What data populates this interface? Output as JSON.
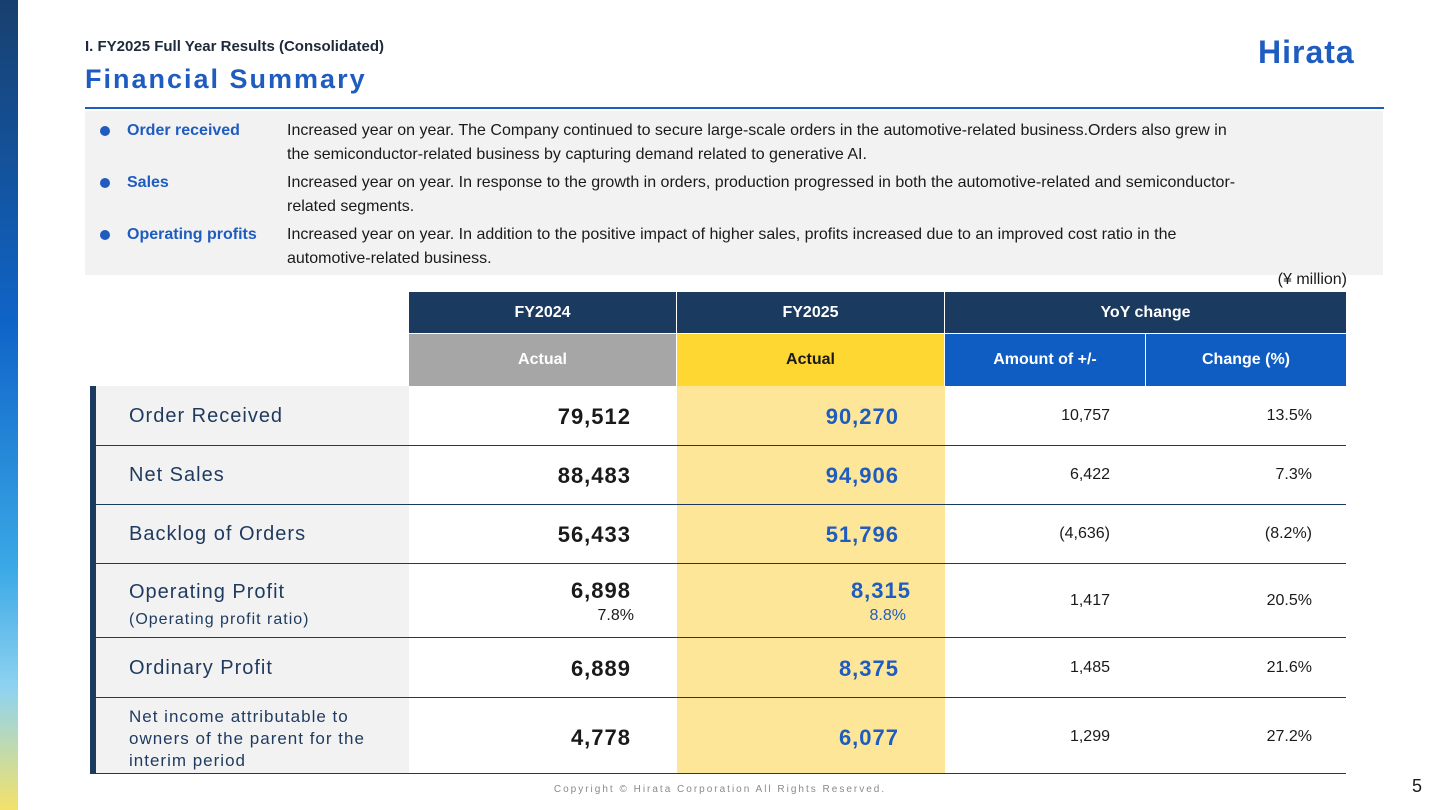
{
  "header": {
    "section": "I. FY2025 Full Year Results (Consolidated)",
    "title": "Financial Summary",
    "logo": "Hirata"
  },
  "summary": [
    {
      "label": "Order received",
      "text_line1": "Increased year on year. The Company continued to secure large-scale orders in the automotive-related business.Orders also grew in",
      "text_line2": "the semiconductor-related business by capturing demand related to generative AI."
    },
    {
      "label": "Sales",
      "text_line1": "Increased year on year. In response to the growth in orders, production progressed in both the automotive-related and semiconductor-",
      "text_line2": "related segments."
    },
    {
      "label": "Operating profits",
      "text_line1": "Increased year on year. In addition to the positive impact of higher sales, profits increased due to an improved cost ratio in the",
      "text_line2": "automotive-related business."
    }
  ],
  "unit_note": "(¥ million)",
  "table": {
    "headers": {
      "fy2024": "FY2024",
      "fy2025": "FY2025",
      "yoy": "YoY change",
      "actual1": "Actual",
      "actual2": "Actual",
      "amount": "Amount of +/-",
      "change": "Change (%)"
    },
    "rows": [
      {
        "label": "Order Received",
        "fy2024": "79,512",
        "fy2025": "90,270",
        "amount": "10,757",
        "change": "13.5%"
      },
      {
        "label": "Net Sales",
        "fy2024": "88,483",
        "fy2025": "94,906",
        "amount": "6,422",
        "change": "7.3%"
      },
      {
        "label": "Backlog of Orders",
        "fy2024": "56,433",
        "fy2025": "51,796",
        "amount": "(4,636)",
        "change": "(8.2%)"
      },
      {
        "label": "Operating Profit",
        "sublabel": "(Operating profit ratio)",
        "fy2024": "6,898",
        "fy2024_sub": "7.8%",
        "fy2025": "8,315",
        "fy2025_sub": "8.8%",
        "amount": "1,417",
        "change": "20.5%"
      },
      {
        "label": "Ordinary Profit",
        "fy2024": "6,889",
        "fy2025": "8,375",
        "amount": "1,485",
        "change": "21.6%"
      },
      {
        "label_line1": "Net income attributable to",
        "label_line2": "owners of the parent for the",
        "label_line3": "interim period",
        "fy2024": "4,778",
        "fy2025": "6,077",
        "amount": "1,299",
        "change": "27.2%"
      }
    ]
  },
  "footer": {
    "copyright": "Copyright © Hirata Corporation All Rights Reserved.",
    "page_number": "5"
  },
  "colors": {
    "brand_blue": "#1f5cbf",
    "navy": "#1b3a5f",
    "highlight_yellow": "#ffd733",
    "highlight_light_yellow": "#fee699"
  }
}
